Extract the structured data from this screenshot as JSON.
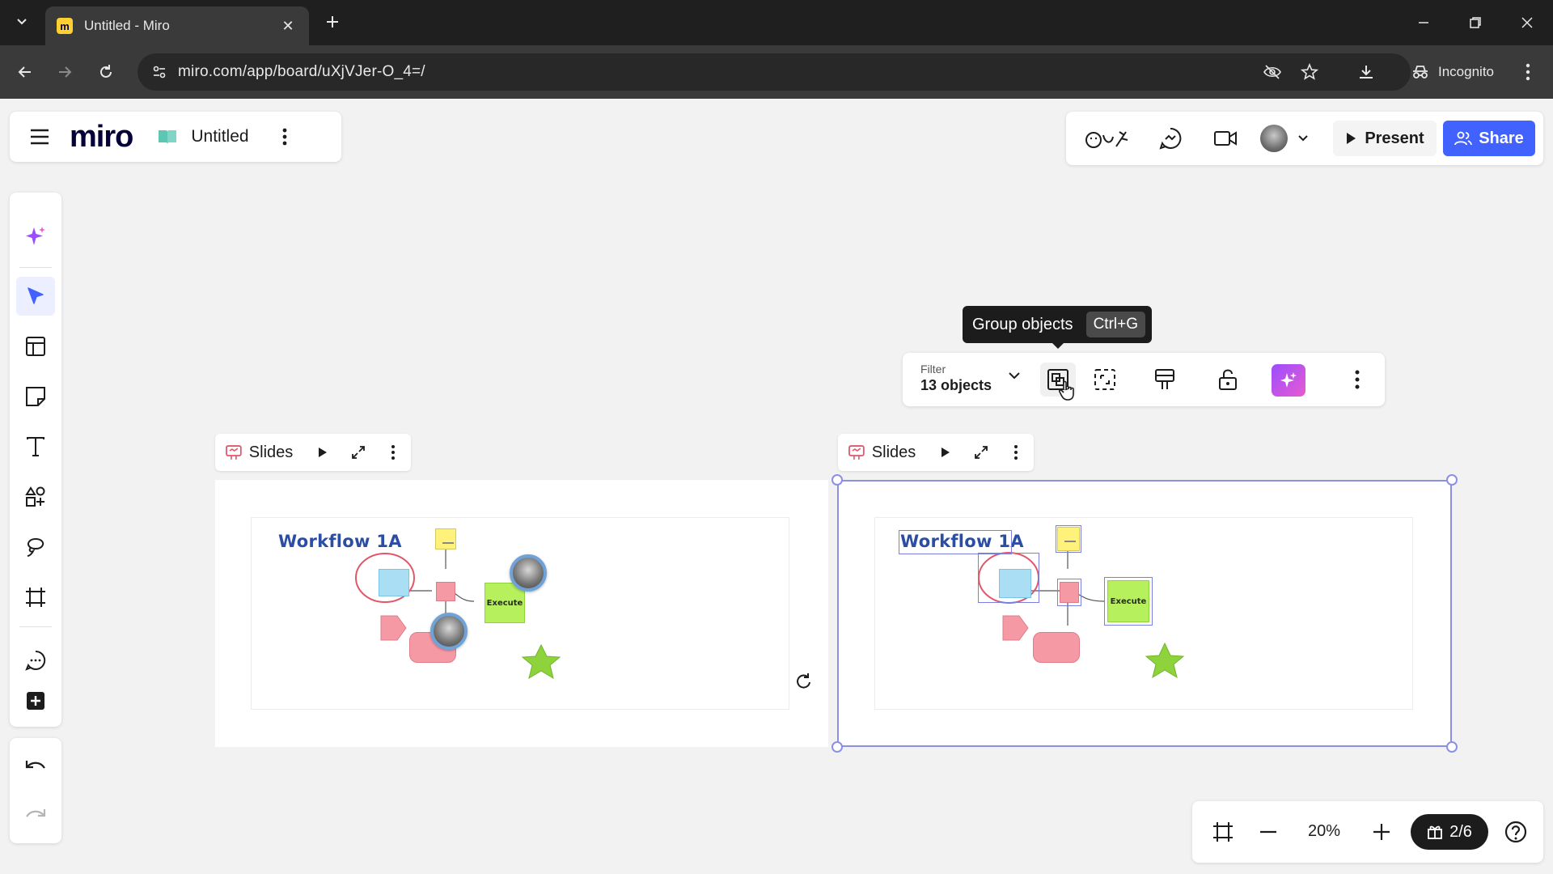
{
  "browser": {
    "tab_title": "Untitled - Miro",
    "favicon_letter": "m",
    "url": "miro.com/app/board/uXjVJer-O_4=/",
    "incognito_label": "Incognito"
  },
  "header": {
    "logo": "miro",
    "board_name": "Untitled"
  },
  "top_right": {
    "present_label": "Present",
    "share_label": "Share"
  },
  "tooltip": {
    "label": "Group objects",
    "shortcut": "Ctrl+G"
  },
  "context_toolbar": {
    "filter_label": "Filter",
    "filter_value": "13 objects"
  },
  "frames": [
    {
      "label": "Slides",
      "title": "Workflow 1A",
      "execute": "Execute"
    },
    {
      "label": "Slides",
      "title": "Workflow 1A",
      "execute": "Execute"
    }
  ],
  "bottom_bar": {
    "zoom": "20%",
    "pages": "2/6"
  },
  "colors": {
    "brand_blue": "#4262ff",
    "selection": "#8c8fe6",
    "ai_gradient_start": "#9b4dff",
    "ai_gradient_end": "#e85bd0"
  }
}
